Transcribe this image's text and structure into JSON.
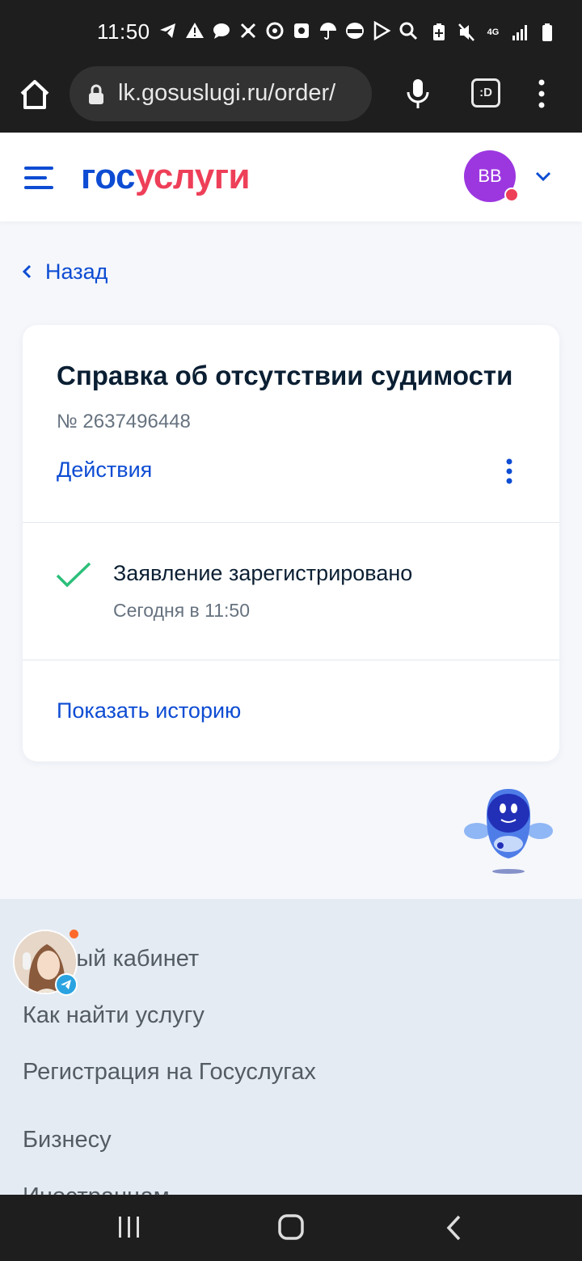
{
  "status_bar": {
    "time": "11:50",
    "network": "4G",
    "notification_icons": [
      "telegram-icon",
      "warning-icon",
      "chat-icon",
      "crossed-icon",
      "vpn-icon",
      "square-icon",
      "umbrella-icon",
      "burger-king-icon",
      "play-icon",
      "search-icon"
    ],
    "right_icons": [
      "battery-saver-icon",
      "mute-icon",
      "network-4g-icon",
      "signal-icon",
      "battery-icon"
    ]
  },
  "browser": {
    "url": "lk.gosuslugi.ru/order/",
    "tabs_label": ":D"
  },
  "header": {
    "logo_part1": "гос",
    "logo_part2": "услуги",
    "avatar_initials": "ВВ"
  },
  "back": {
    "label": "Назад"
  },
  "order": {
    "title": "Справка об отсутствии судимости",
    "number": "№ 2637496448",
    "actions_label": "Действия",
    "status": {
      "title": "Заявление зарегистрировано",
      "time": "Сегодня в 11:50"
    },
    "history_link": "Показать историю"
  },
  "footer": {
    "links": [
      "Личный кабинет",
      "Как найти услугу",
      "Регистрация на Госуслугах",
      "Бизнесу",
      "Иностранцам"
    ]
  },
  "colors": {
    "brand_blue": "#0d4cd3",
    "brand_red": "#ee3f58",
    "avatar_purple": "#9c37e0",
    "success_green": "#2cbf7a"
  }
}
